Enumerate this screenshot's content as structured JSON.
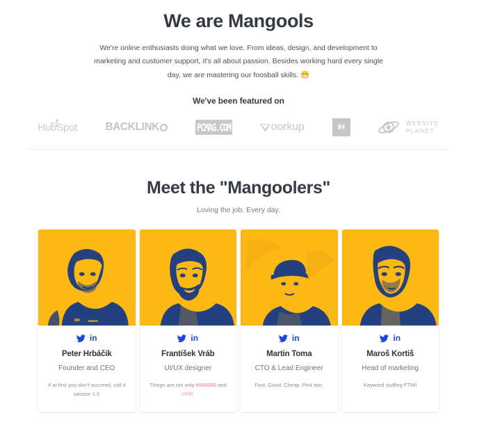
{
  "hero": {
    "title": "We are Mangools",
    "description": "We're online enthusiasts doing what we love. From ideas, design, and development to marketing and customer support, it's all about passion. Besides working hard every single day, we are mastering our foosball skills.",
    "emoji": "😁"
  },
  "featured": {
    "title": "We've been featured on",
    "logos": [
      {
        "name": "hubspot-logo",
        "label": "HubSpot"
      },
      {
        "name": "backlinko-logo",
        "label": "BACKLINK"
      },
      {
        "name": "pcmag-logo",
        "label": "PCMAG.COM"
      },
      {
        "name": "woorkup-logo",
        "label": "oorkup"
      },
      {
        "name": "indiehackers-logo",
        "label": "IH"
      },
      {
        "name": "website-planet-logo",
        "label_line1": "WEBSITE",
        "label_line2": "PLANET"
      }
    ]
  },
  "team": {
    "title": "Meet the \"Mangoolers\"",
    "subtitle": "Loving the job. Every day.",
    "social_labels": {
      "twitter": "twitter-icon",
      "linkedin": "in"
    },
    "members": [
      {
        "name": "Peter Hrbáčik",
        "role": "Founder and CEO",
        "quote": "If at first you don't succeed; call it version 1.0",
        "photo_bg": "#fcb813"
      },
      {
        "name": "František Vráb",
        "role": "UI/UX designer",
        "quote_pre": "Things are not only ",
        "quote_hex1": "#000000",
        "quote_mid": " and ",
        "quote_hex2": "#ffffff.",
        "photo_bg": "#fcb813"
      },
      {
        "name": "Martin Toma",
        "role": "CTO & Lead Engineer",
        "quote": "Fast, Good, Cheap. Pick two.",
        "photo_bg": "#fcb813"
      },
      {
        "name": "Maroš Kortiš",
        "role": "Head of marketing",
        "quote": "Keyword stuffing FTW!",
        "photo_bg": "#fcb813"
      }
    ]
  },
  "colors": {
    "brand_yellow": "#fcb813",
    "duotone_dark": "#1f3a7a",
    "heading": "#353b45",
    "body_text": "#4a5159",
    "muted": "#8a9099",
    "social_blue": "#1b47d8",
    "logo_gray": "#c5c7ca",
    "divider": "#ebecee"
  }
}
